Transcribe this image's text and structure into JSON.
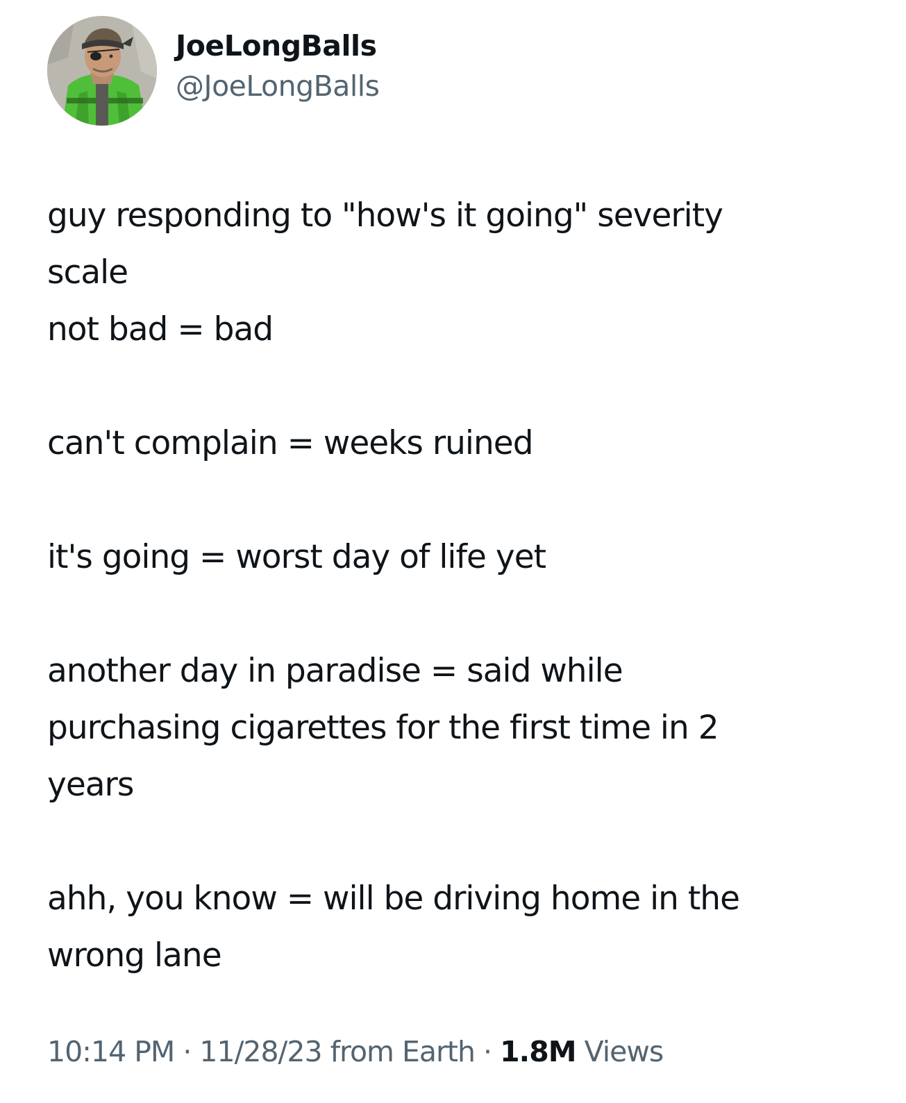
{
  "author": {
    "display_name": "JoeLongBalls",
    "handle": "@JoeLongBalls",
    "avatar_icon": "illustrated-soldier-avatar"
  },
  "tweet": {
    "lines": [
      "guy responding to \"how's it going\" severity",
      "scale",
      "not bad = bad",
      "",
      "can't complain = weeks ruined",
      "",
      "it's going = worst day of life yet",
      "",
      "another day in paradise = said while",
      "purchasing cigarettes for the first time in 2",
      "years",
      "",
      "ahh, you know = will be driving home in the",
      "wrong lane"
    ]
  },
  "meta": {
    "time": "10:14 PM",
    "separator": " · ",
    "date": "11/28/23",
    "source": " from Earth",
    "views_count": "1.8M",
    "views_label": " Views"
  },
  "colors": {
    "text_primary": "#0f1419",
    "text_secondary": "#536471",
    "background": "#ffffff"
  }
}
